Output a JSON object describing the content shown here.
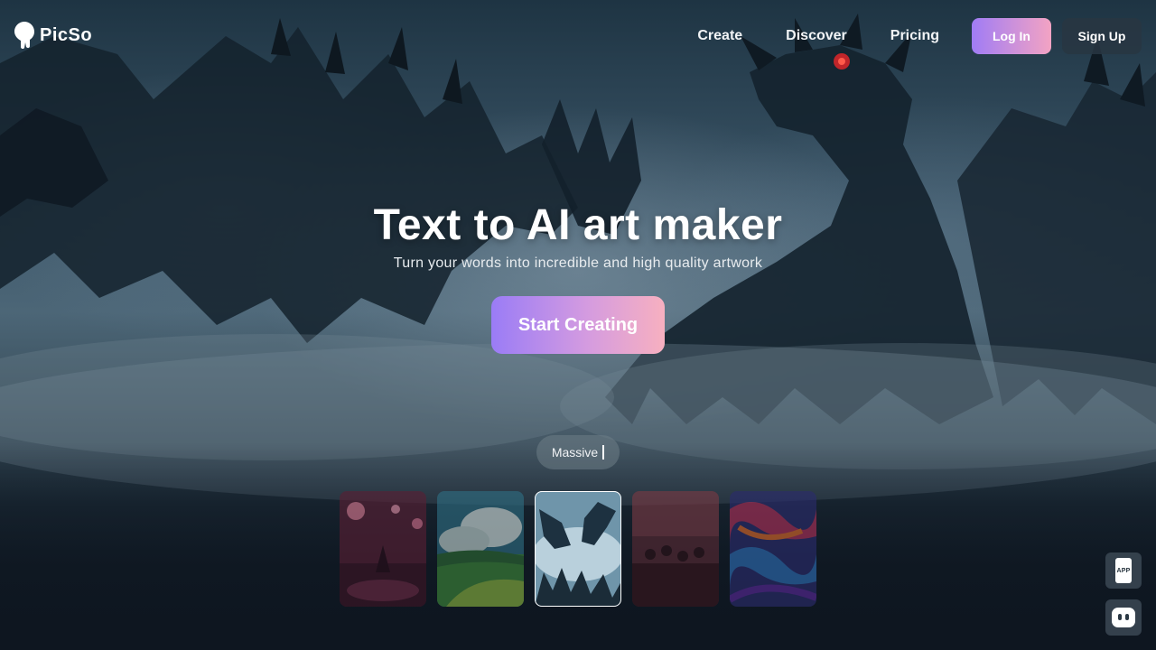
{
  "app": {
    "brand": "PicSo"
  },
  "nav": {
    "links": [
      "Create",
      "Discover",
      "Pricing"
    ],
    "login_label": "Log In",
    "signup_label": "Sign Up"
  },
  "hero": {
    "title": "Text to AI art maker",
    "subtitle": "Turn your words into incredible and high quality artwork",
    "cta_label": "Start Creating"
  },
  "style_selector": {
    "current_style": "Massive"
  },
  "gallery": {
    "active_index": 2,
    "thumbnails": [
      {
        "icon": "dark-fantasy-thumbnail"
      },
      {
        "icon": "anime-landscape-thumbnail"
      },
      {
        "icon": "dragon-thumbnail"
      },
      {
        "icon": "crowd-scene-thumbnail"
      },
      {
        "icon": "abstract-colorful-thumbnail"
      }
    ]
  },
  "widgets": {
    "app_badge": "APP",
    "chat": "chat-bot-icon"
  },
  "colors": {
    "accent_start": "#9a7cf6",
    "accent_end": "#f7b0c0",
    "background": "#0e1620"
  }
}
